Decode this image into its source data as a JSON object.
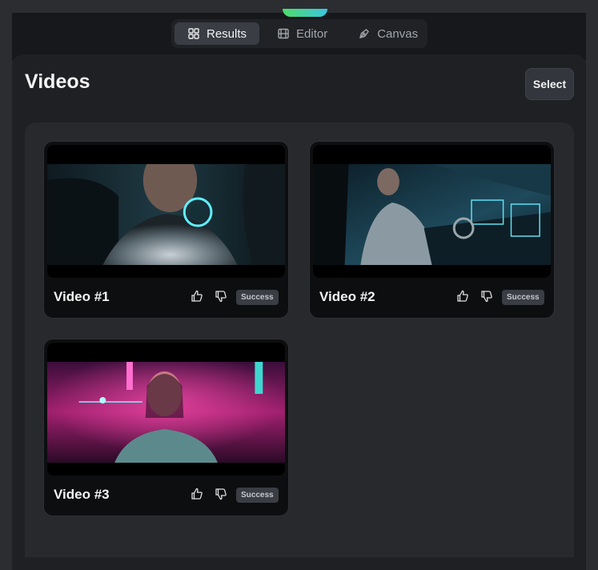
{
  "tabs": [
    {
      "label": "Results",
      "icon": "grid-icon",
      "active": true
    },
    {
      "label": "Editor",
      "icon": "film-icon",
      "active": false
    },
    {
      "label": "Canvas",
      "icon": "pen-icon",
      "active": false
    }
  ],
  "page": {
    "title": "Videos",
    "select_label": "Select"
  },
  "videos": [
    {
      "title": "Video #1",
      "status": "Success"
    },
    {
      "title": "Video #2",
      "status": "Success"
    },
    {
      "title": "Video #3",
      "status": "Success"
    }
  ],
  "colors": {
    "accent_gradient_start": "#4ddc6a",
    "accent_gradient_end": "#3ac6e0"
  }
}
